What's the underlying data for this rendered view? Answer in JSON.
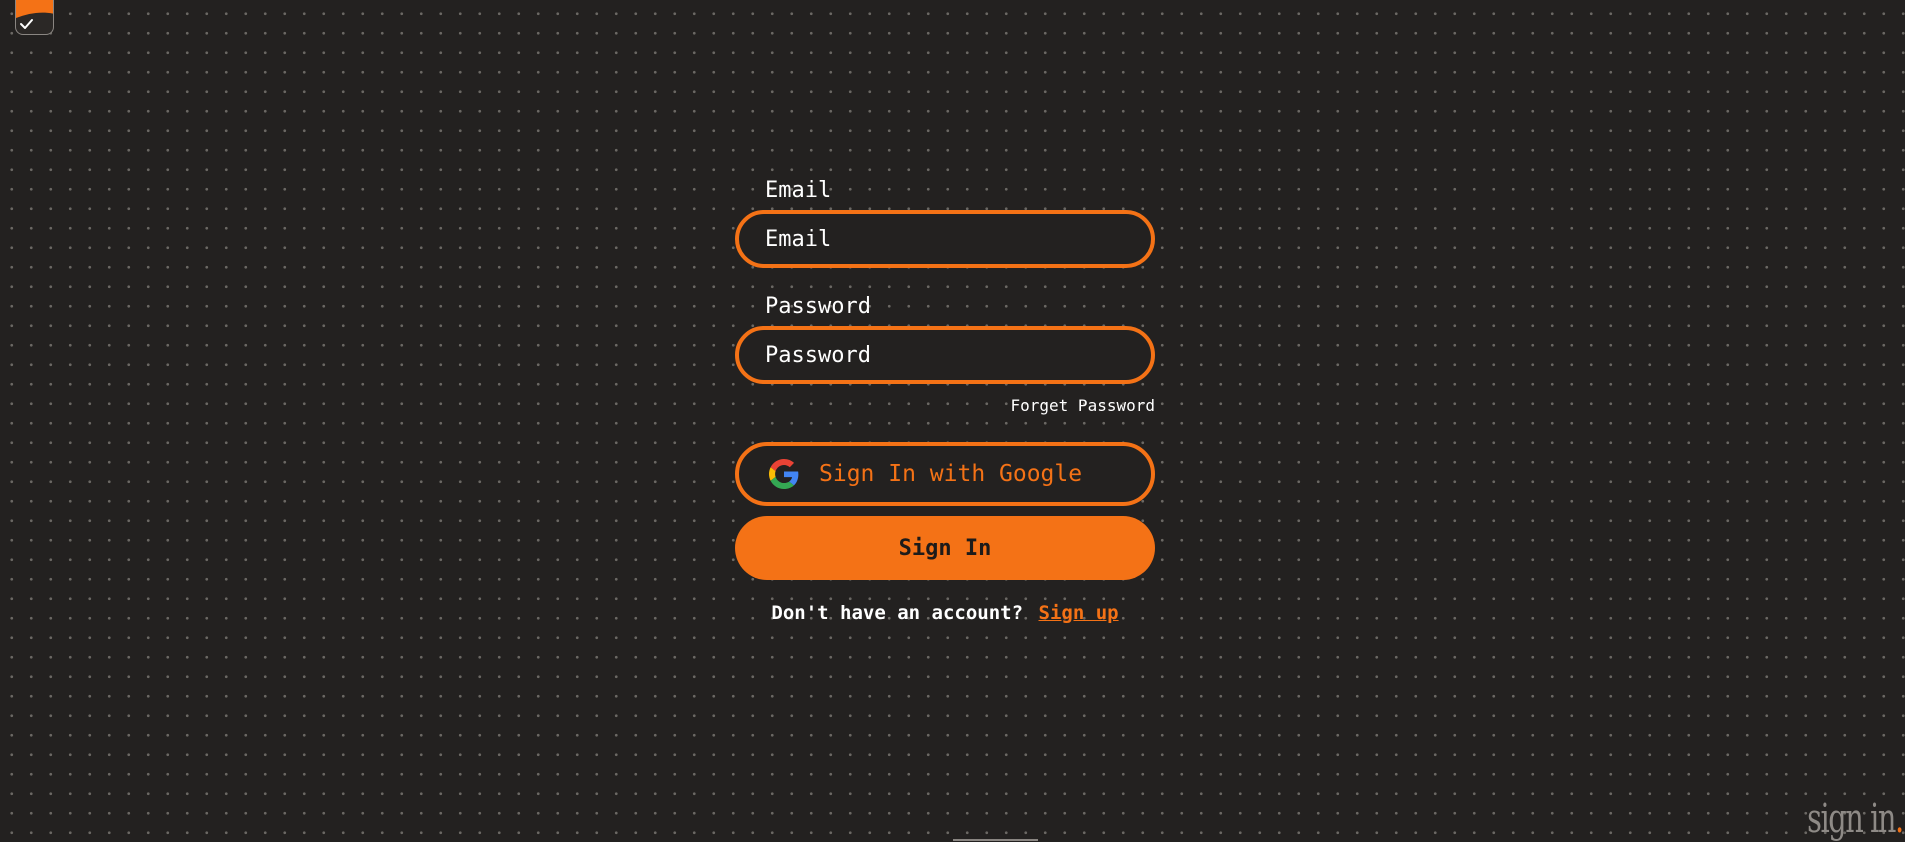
{
  "app": {
    "logo_icon": "app-check-logo-icon"
  },
  "form": {
    "email_label": "Email",
    "email_placeholder": "Email",
    "email_value": "",
    "password_label": "Password",
    "password_placeholder": "Password",
    "password_value": "",
    "forget_password": "Forget Password",
    "google_button": "Sign In with Google",
    "google_icon": "google-icon",
    "signin_button": "Sign In",
    "no_account_text": "Don't have an account?",
    "signup_link": "Sign up"
  },
  "brand": {
    "text": "sign in",
    "dot": "."
  },
  "colors": {
    "accent": "#f47216",
    "background": "#232120",
    "text": "#ffffff",
    "brand_gray": "#8e8a86"
  }
}
